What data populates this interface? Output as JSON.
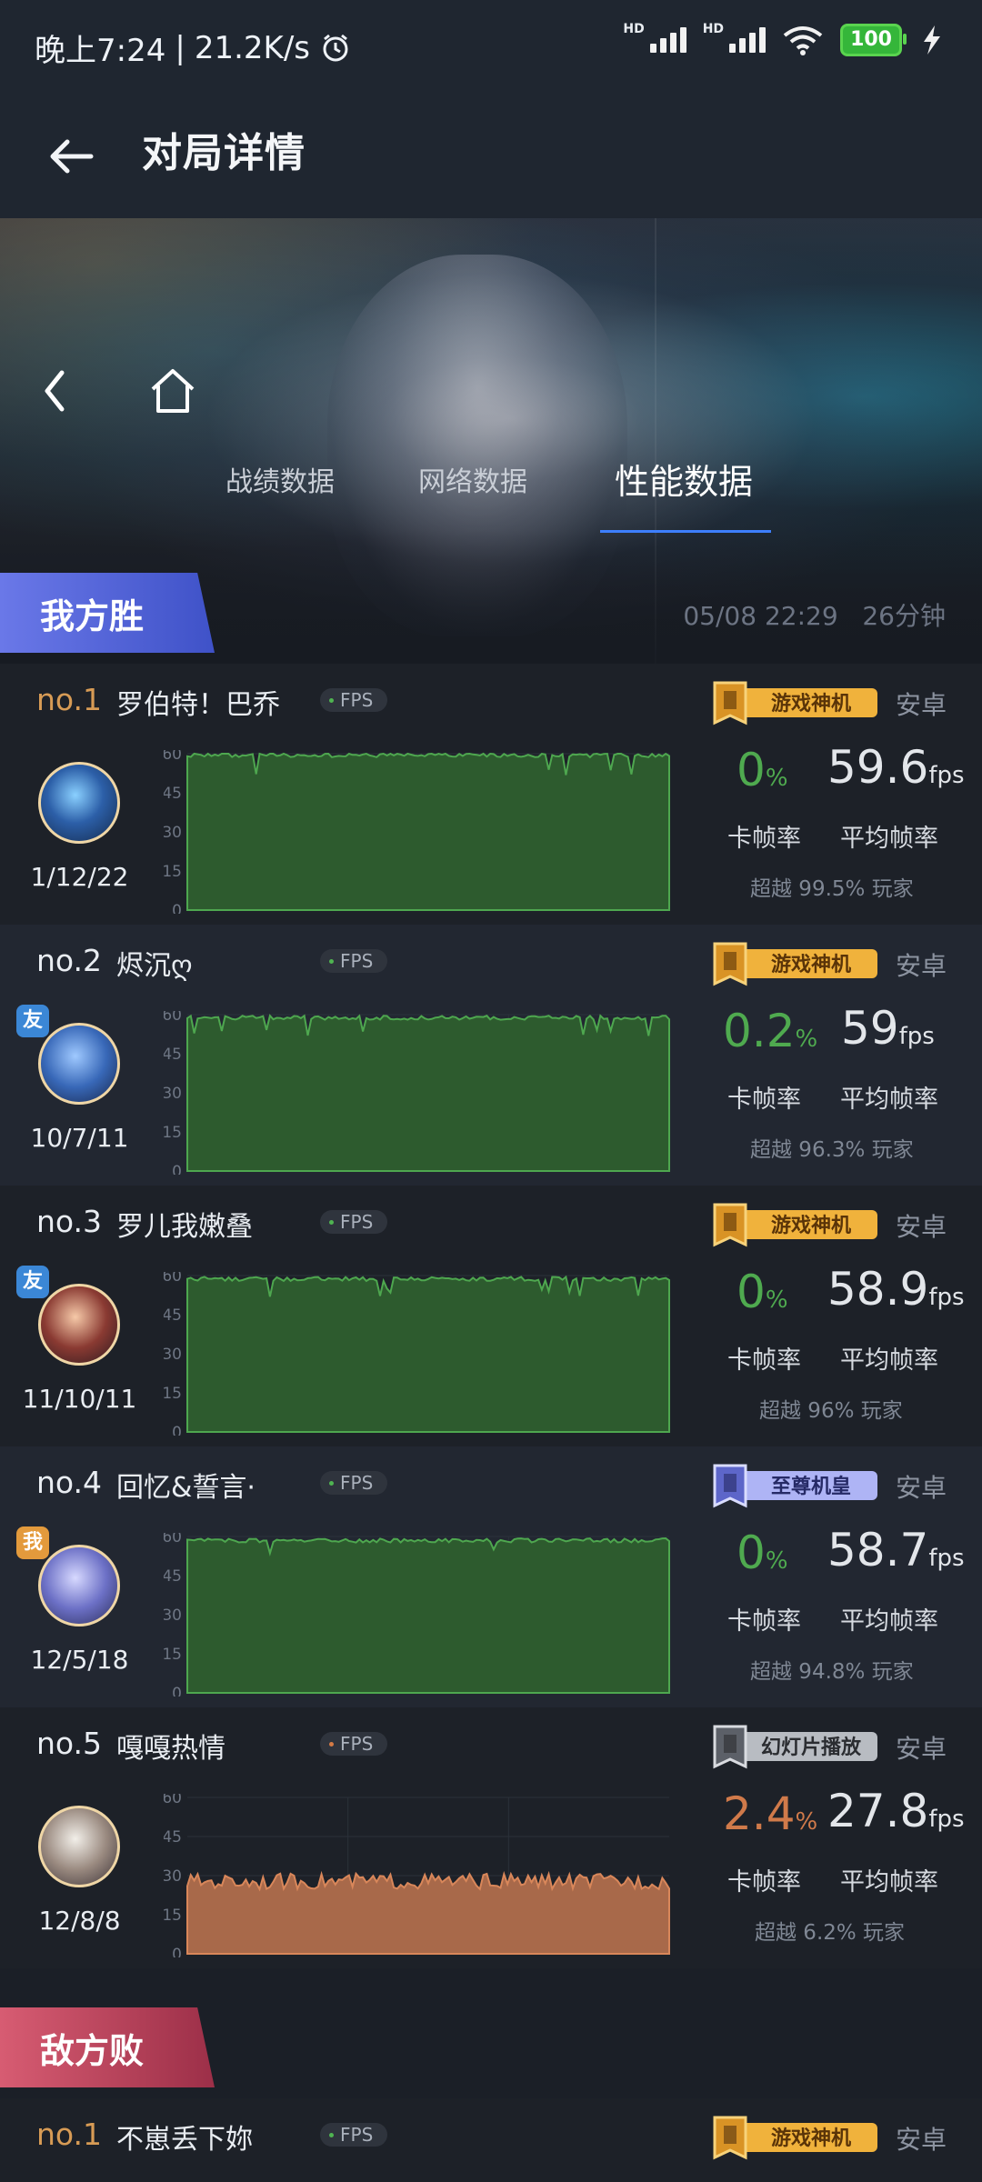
{
  "statusbar": {
    "time": "晚上7:24",
    "net_speed": "21.2K/s",
    "battery": "100"
  },
  "appbar": {
    "title": "对局详情"
  },
  "hero": {
    "tabs": [
      "战绩数据",
      "网络数据",
      "性能数据"
    ],
    "active_tab": "性能数据"
  },
  "my_team": {
    "label": "我方胜",
    "date": "05/08 22:29",
    "duration": "26分钟"
  },
  "enemy_team": {
    "label": "敌方败"
  },
  "common": {
    "fps_tag": "FPS",
    "stutter_label": "卡帧率",
    "avg_label": "平均帧率",
    "fps_unit": "fps",
    "percent": "%"
  },
  "colors": {
    "green": "#4faa4f",
    "orange": "#d07a4a",
    "chart_green": "#2d5b2e",
    "chart_orange": "#a8694a"
  },
  "players": [
    {
      "rank": "no.1",
      "name": "罗伯特！巴乔",
      "badge": "游戏神机",
      "platform": "安卓",
      "kda": "1/12/22",
      "stutter": "0",
      "avg_fps": "59.6",
      "beat": "超越 99.5% 玩家",
      "tag": ""
    },
    {
      "rank": "no.2",
      "name": "烬沉ღ",
      "badge": "游戏神机",
      "platform": "安卓",
      "kda": "10/7/11",
      "stutter": "0.2",
      "avg_fps": "59",
      "beat": "超越 96.3% 玩家",
      "tag": "友"
    },
    {
      "rank": "no.3",
      "name": "罗儿我嫩叠",
      "badge": "游戏神机",
      "platform": "安卓",
      "kda": "11/10/11",
      "stutter": "0",
      "avg_fps": "58.9",
      "beat": "超越 96% 玩家",
      "tag": "友"
    },
    {
      "rank": "no.4",
      "name": "回忆&誓言·",
      "badge": "至尊机皇",
      "platform": "安卓",
      "kda": "12/5/18",
      "stutter": "0",
      "avg_fps": "58.7",
      "beat": "超越 94.8% 玩家",
      "tag": "我"
    },
    {
      "rank": "no.5",
      "name": "嘎嘎热情",
      "badge": "幻灯片播放",
      "platform": "安卓",
      "kda": "12/8/8",
      "stutter": "2.4",
      "avg_fps": "27.8",
      "beat": "超越 6.2% 玩家",
      "tag": ""
    }
  ],
  "enemy_players": [
    {
      "rank": "no.1",
      "name": "不崽丢下妳",
      "badge": "游戏神机",
      "platform": "安卓"
    }
  ],
  "chart_data": [
    {
      "type": "area",
      "title": "no.1 罗伯特！巴乔",
      "y_ticks": [
        0,
        15,
        30,
        45,
        60
      ],
      "ylim": [
        0,
        60
      ],
      "avg": 59.6
    },
    {
      "type": "area",
      "title": "no.2 烬沉ღ",
      "y_ticks": [
        0,
        15,
        30,
        45,
        60
      ],
      "ylim": [
        0,
        60
      ],
      "avg": 59
    },
    {
      "type": "area",
      "title": "no.3 罗儿我嫩叠",
      "y_ticks": [
        0,
        15,
        30,
        45,
        60
      ],
      "ylim": [
        0,
        60
      ],
      "avg": 58.9
    },
    {
      "type": "area",
      "title": "no.4 回忆&誓言·",
      "y_ticks": [
        0,
        15,
        30,
        45,
        60
      ],
      "ylim": [
        0,
        60
      ],
      "avg": 58.7
    },
    {
      "type": "area",
      "title": "no.5 嘎嘎热情",
      "y_ticks": [
        0,
        15,
        30,
        45,
        60
      ],
      "ylim": [
        0,
        60
      ],
      "avg": 27.8
    }
  ]
}
